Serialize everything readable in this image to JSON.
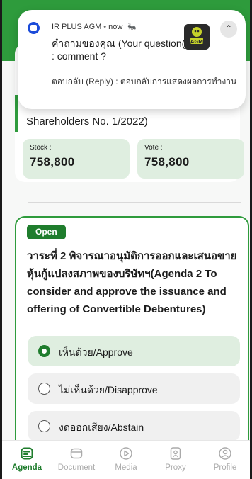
{
  "colors": {
    "primary": "#2e9b3c",
    "primary_dark": "#1f7d2d",
    "selected_bg": "#dfeee0",
    "notification_app_icon": "#1b4bd9"
  },
  "notification": {
    "app_name": "IR PLUS AGM",
    "time": "now",
    "icon": "pin-icon",
    "title": "คำถามของคุณ (Your question(s)) : comment ?",
    "body": "ตอบกลับ (Reply) : ตอบกลับการแสดงผลการทำงาน",
    "logo_text": "AGM"
  },
  "meeting": {
    "name": "Shareholders No. 1/2022)",
    "stock_label": "Stock :",
    "stock_value": "758,800",
    "vote_label": "Vote :",
    "vote_value": "758,800"
  },
  "agenda": {
    "status": "Open",
    "title": "วาระที่ 2 พิจารณาอนุมัติการออกและเสนอขายหุ้นกู้แปลงสภาพของบริษัทฯ(Agenda 2 To consider and approve the issuance and offering of Convertible Debentures)",
    "options": [
      {
        "label": "เห็นด้วย/Approve",
        "selected": true
      },
      {
        "label": "ไม่เห็นด้วย/Disapprove",
        "selected": false
      },
      {
        "label": "งดออกเสียง/Abstain",
        "selected": false
      }
    ]
  },
  "nav": [
    {
      "label": "Agenda",
      "icon": "agenda-icon",
      "active": true
    },
    {
      "label": "Document",
      "icon": "document-icon",
      "active": false
    },
    {
      "label": "Media",
      "icon": "media-icon",
      "active": false
    },
    {
      "label": "Proxy",
      "icon": "proxy-icon",
      "active": false
    },
    {
      "label": "Profile",
      "icon": "profile-icon",
      "active": false
    }
  ]
}
